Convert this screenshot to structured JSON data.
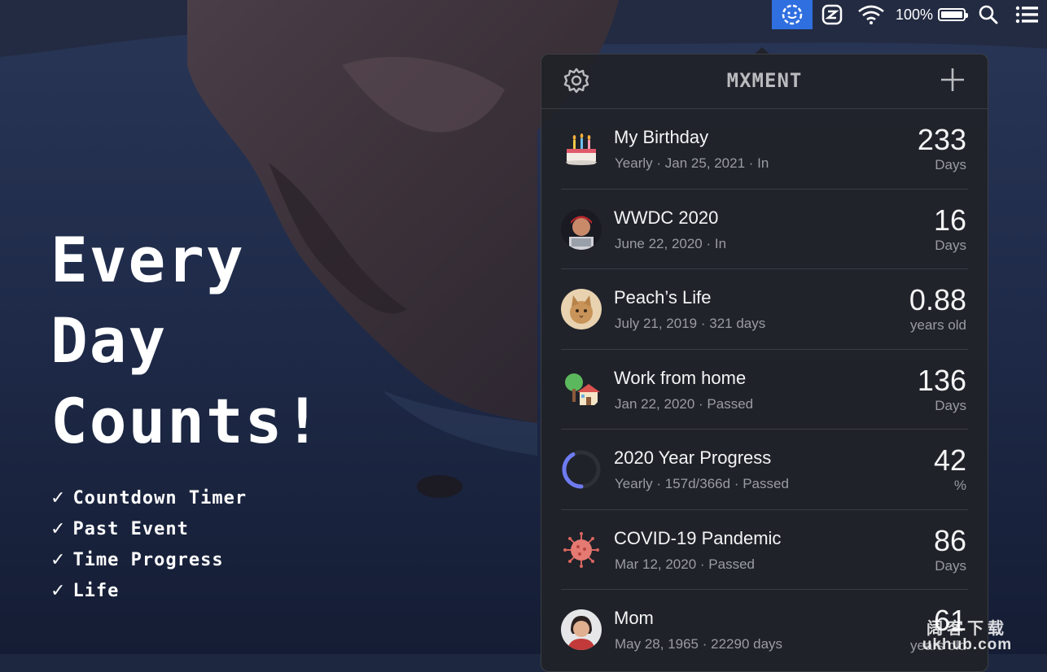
{
  "menubar": {
    "battery_percent": "100%",
    "icons": [
      "moment-app-icon",
      "clipboard-app-icon",
      "wifi-icon",
      "battery-icon",
      "search-icon",
      "control-center-icon"
    ]
  },
  "hero": {
    "headline": [
      "Every",
      "Day",
      "Counts!"
    ],
    "features": [
      "Countdown Timer",
      "Past Event",
      "Time Progress",
      "Life"
    ],
    "check_glyph": "✓"
  },
  "panel": {
    "brand": "MXMENT",
    "events": [
      {
        "title": "My Birthday",
        "subtitle": "Yearly · Jan 25, 2021 · In",
        "value": "233",
        "unit": "Days",
        "icon": "birthday-cake-icon"
      },
      {
        "title": "WWDC 2020",
        "subtitle": "June 22, 2020 · In",
        "value": "16",
        "unit": "Days",
        "icon": "wwdc-memoji-icon"
      },
      {
        "title": "Peach’s Life",
        "subtitle": "July 21, 2019 · 321 days",
        "value": "0.88",
        "unit": "years old",
        "icon": "cat-photo-icon"
      },
      {
        "title": "Work from home",
        "subtitle": "Jan 22, 2020 · Passed",
        "value": "136",
        "unit": "Days",
        "icon": "house-with-tree-icon"
      },
      {
        "title": "2020 Year Progress",
        "subtitle": "Yearly · 157d/366d · Passed",
        "value": "42",
        "unit": "%",
        "icon": "progress-ring-icon",
        "progress": 0.42
      },
      {
        "title": "COVID-19 Pandemic",
        "subtitle": "Mar 12, 2020 · Passed",
        "value": "86",
        "unit": "Days",
        "icon": "virus-icon"
      },
      {
        "title": "Mom",
        "subtitle": "May 28, 1965  ·  22290 days",
        "value": "61",
        "unit": "years old",
        "icon": "mom-photo-icon"
      }
    ]
  },
  "watermark": {
    "line1": "阔客下载",
    "line2": "ukhub.com"
  },
  "colors": {
    "accent": "#2f6fe0",
    "progress": "#6e7bf0",
    "panel": "#202228"
  }
}
